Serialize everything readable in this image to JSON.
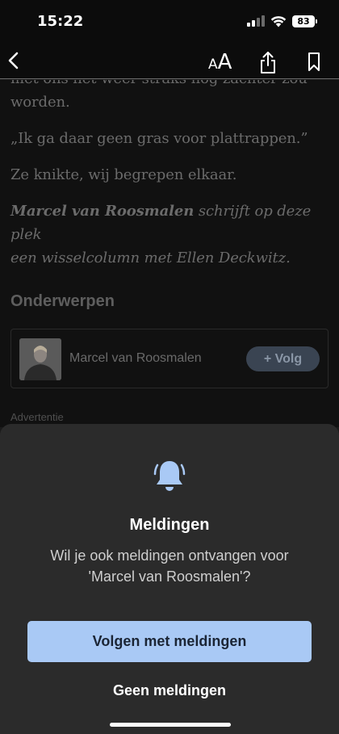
{
  "status_bar": {
    "time": "15:22",
    "battery": "83"
  },
  "toolbar": {
    "font_size_small": "A",
    "font_size_large": "A"
  },
  "article": {
    "cut_line": "met ons het weer straks nog zachter zou",
    "line_worden": "worden.",
    "quote": "„Ik ga daar geen gras voor plattrappen.”",
    "line2": "Ze knikte, wij begrepen elkaar.",
    "author_bold": "Marcel van Roosmalen",
    "author_rest_1": " schrijft op deze plek",
    "author_rest_2": "een wisselcolumn met Ellen Deckwitz."
  },
  "topics": {
    "title": "Onderwerpen",
    "items": [
      {
        "name": "Marcel van Roosmalen",
        "follow_label": "+ Volg"
      }
    ]
  },
  "ad_label": "Advertentie",
  "sheet": {
    "title": "Meldingen",
    "text_line1": "Wil je ook meldingen ontvangen voor",
    "text_line2": "'Marcel van Roosmalen'?",
    "primary_label": "Volgen met meldingen",
    "secondary_label": "Geen meldingen"
  },
  "colors": {
    "accent": "#a9c9f5",
    "sheet_bg": "#2b2b2b",
    "follow_btn": "#3a4452"
  },
  "icons": [
    "back-icon",
    "font-size-icon",
    "share-icon",
    "bookmark-icon",
    "bell-icon",
    "signal-icon",
    "wifi-icon",
    "battery-icon"
  ]
}
